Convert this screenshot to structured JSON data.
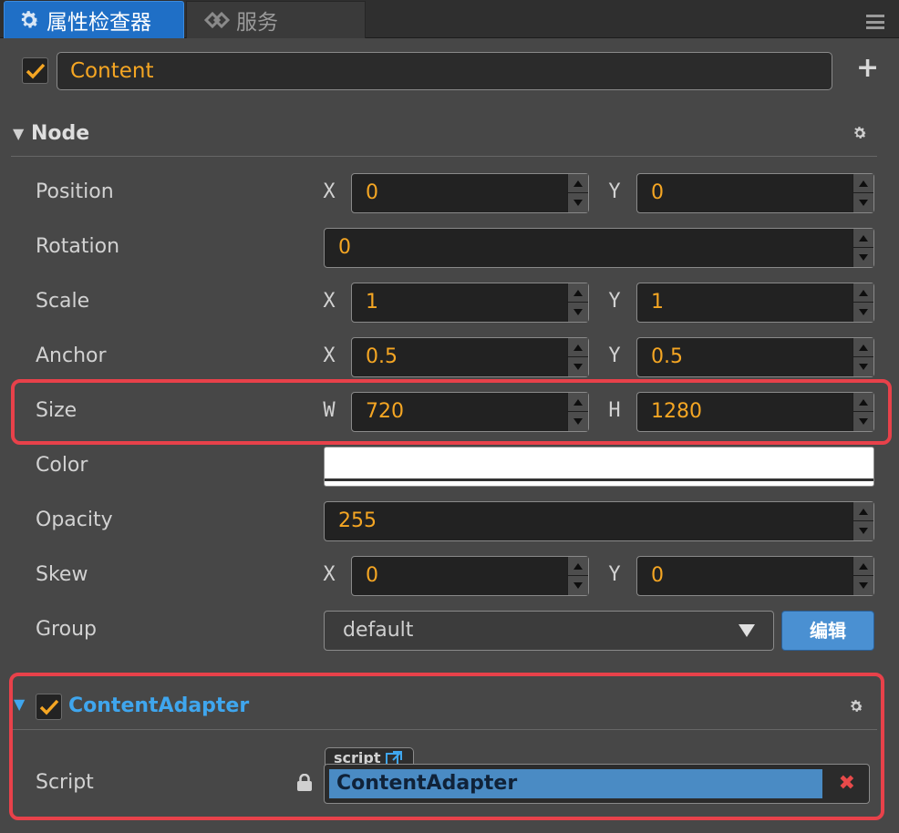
{
  "tabs": [
    {
      "label": "属性检查器",
      "icon": "gear-icon",
      "active": true
    },
    {
      "label": "服务",
      "icon": "service-icon",
      "active": false
    }
  ],
  "node": {
    "active": true,
    "name": "Content"
  },
  "section": {
    "title": "Node"
  },
  "properties": {
    "position": {
      "label": "Position",
      "x_label": "X",
      "x": "0",
      "y_label": "Y",
      "y": "0"
    },
    "rotation": {
      "label": "Rotation",
      "value": "0"
    },
    "scale": {
      "label": "Scale",
      "x_label": "X",
      "x": "1",
      "y_label": "Y",
      "y": "1"
    },
    "anchor": {
      "label": "Anchor",
      "x_label": "X",
      "x": "0.5",
      "y_label": "Y",
      "y": "0.5"
    },
    "size": {
      "label": "Size",
      "w_label": "W",
      "w": "720",
      "h_label": "H",
      "h": "1280"
    },
    "color": {
      "label": "Color",
      "value": "#ffffff"
    },
    "opacity": {
      "label": "Opacity",
      "value": "255"
    },
    "skew": {
      "label": "Skew",
      "x_label": "X",
      "x": "0",
      "y_label": "Y",
      "y": "0"
    },
    "group": {
      "label": "Group",
      "value": "default",
      "edit_label": "编辑"
    }
  },
  "component": {
    "enabled": true,
    "title": "ContentAdapter",
    "script_label": "Script",
    "script_tag": "script",
    "script_value": "ContentAdapter"
  },
  "colors": {
    "accent_blue": "#1f6fc6",
    "value_orange": "#f5a623",
    "component_title": "#3fa6ee",
    "highlight_red": "#e8414a"
  }
}
